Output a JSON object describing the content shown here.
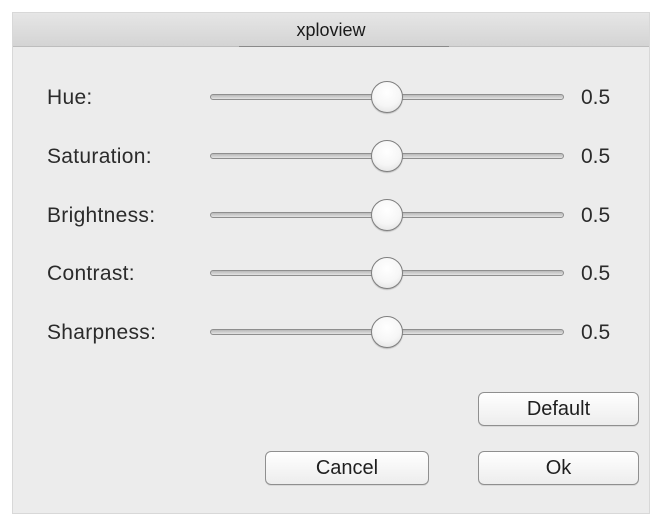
{
  "window": {
    "title": "xploview"
  },
  "sliders": [
    {
      "label": "Hue:",
      "value_text": "0.5",
      "value": 0.5
    },
    {
      "label": "Saturation:",
      "value_text": "0.5",
      "value": 0.5
    },
    {
      "label": "Brightness:",
      "value_text": "0.5",
      "value": 0.5
    },
    {
      "label": "Contrast:",
      "value_text": "0.5",
      "value": 0.5
    },
    {
      "label": "Sharpness:",
      "value_text": "0.5",
      "value": 0.5
    }
  ],
  "buttons": {
    "default_label": "Default",
    "cancel_label": "Cancel",
    "ok_label": "Ok"
  }
}
